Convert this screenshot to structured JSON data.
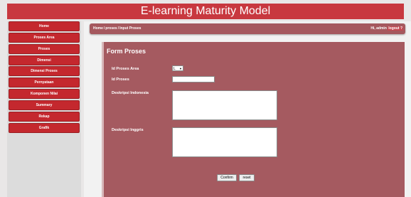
{
  "header": {
    "title": "E-learning Maturity Model"
  },
  "sidebar": {
    "items": [
      {
        "label": "Home"
      },
      {
        "label": "Proses Area"
      },
      {
        "label": "Proses"
      },
      {
        "label": "Dimensi"
      },
      {
        "label": "Dimensi Proses"
      },
      {
        "label": "Pernyataan"
      },
      {
        "label": "Komponen Nilai"
      },
      {
        "label": "Summary"
      },
      {
        "label": "Rekap"
      },
      {
        "label": "Grafik"
      }
    ]
  },
  "breadcrumb": {
    "home": "Home",
    "sep": "/",
    "proses": "proses",
    "current": "Input Proses"
  },
  "user": {
    "greeting": "Hi,",
    "name": "admin",
    "logout": "logout ?"
  },
  "form": {
    "title": "Form Proses",
    "fields": {
      "id_proses_area": {
        "label": "Id Proses Area",
        "value": "L"
      },
      "id_proses": {
        "label": "Id Proses",
        "value": ""
      },
      "deskripsi_indonesia": {
        "label": "Deskripsi Indonesia",
        "value": ""
      },
      "deskripsi_inggris": {
        "label": "Deskripsi Inggris",
        "value": ""
      }
    },
    "buttons": {
      "confirm": "Confirm",
      "reset": "reset"
    }
  },
  "colors": {
    "header": "#c8383f",
    "sidebar_item": "#c4282e",
    "panel": "#a55a60"
  }
}
